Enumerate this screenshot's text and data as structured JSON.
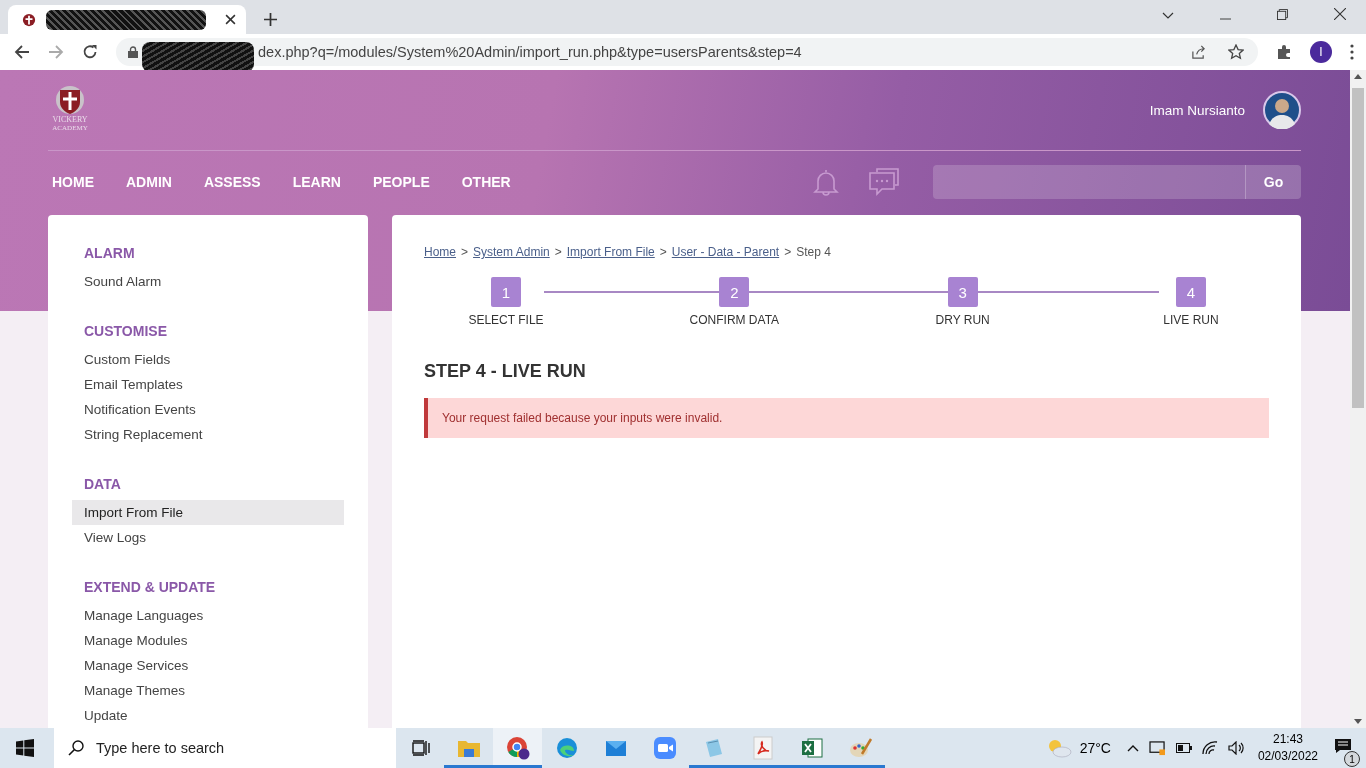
{
  "browser": {
    "url": "dex.php?q=/modules/System%20Admin/import_run.php&type=usersParents&step=4",
    "profile_initial": "I"
  },
  "header": {
    "logo_name": "VICKERY",
    "logo_sub": "ACADEMY",
    "user_name": "Imam Nursianto",
    "nav": [
      "HOME",
      "ADMIN",
      "ASSESS",
      "LEARN",
      "PEOPLE",
      "OTHER"
    ],
    "search_button": "Go"
  },
  "sidebar": [
    {
      "title": "ALARM",
      "items": [
        {
          "label": "Sound Alarm",
          "selected": false
        }
      ]
    },
    {
      "title": "CUSTOMISE",
      "items": [
        {
          "label": "Custom Fields",
          "selected": false
        },
        {
          "label": "Email Templates",
          "selected": false
        },
        {
          "label": "Notification Events",
          "selected": false
        },
        {
          "label": "String Replacement",
          "selected": false
        }
      ]
    },
    {
      "title": "DATA",
      "items": [
        {
          "label": "Import From File",
          "selected": true
        },
        {
          "label": "View Logs",
          "selected": false
        }
      ]
    },
    {
      "title": "EXTEND & UPDATE",
      "items": [
        {
          "label": "Manage Languages",
          "selected": false
        },
        {
          "label": "Manage Modules",
          "selected": false
        },
        {
          "label": "Manage Services",
          "selected": false
        },
        {
          "label": "Manage Themes",
          "selected": false
        },
        {
          "label": "Update",
          "selected": false
        }
      ]
    }
  ],
  "breadcrumb_separator": ">",
  "breadcrumb": [
    {
      "label": "Home",
      "link": true
    },
    {
      "label": "System Admin",
      "link": true
    },
    {
      "label": "Import From File",
      "link": true
    },
    {
      "label": "User - Data - Parent",
      "link": true
    },
    {
      "label": "Step 4",
      "link": false
    }
  ],
  "steps": [
    {
      "number": "1",
      "label": "SELECT FILE"
    },
    {
      "number": "2",
      "label": "CONFIRM DATA"
    },
    {
      "number": "3",
      "label": "DRY RUN"
    },
    {
      "number": "4",
      "label": "LIVE RUN"
    }
  ],
  "heading": "STEP 4 - LIVE RUN",
  "alert": {
    "kind": "error",
    "message": "Your request failed because your inputs were invalid."
  },
  "taskbar": {
    "search_placeholder": "Type here to search",
    "apps": [
      {
        "kind": "folder",
        "running": true,
        "selected": false
      },
      {
        "kind": "chrome",
        "running": true,
        "selected": true
      },
      {
        "kind": "edge",
        "running": false,
        "selected": false
      },
      {
        "kind": "mail",
        "running": false,
        "selected": false
      },
      {
        "kind": "video",
        "running": false,
        "selected": false
      },
      {
        "kind": "notepad",
        "running": true,
        "selected": false
      },
      {
        "kind": "pdf",
        "running": true,
        "selected": false
      },
      {
        "kind": "excel",
        "running": true,
        "selected": false
      },
      {
        "kind": "paint",
        "running": true,
        "selected": false
      }
    ],
    "temperature": "27°C",
    "time": "21:43",
    "date": "02/03/2022",
    "notifications": "1"
  }
}
